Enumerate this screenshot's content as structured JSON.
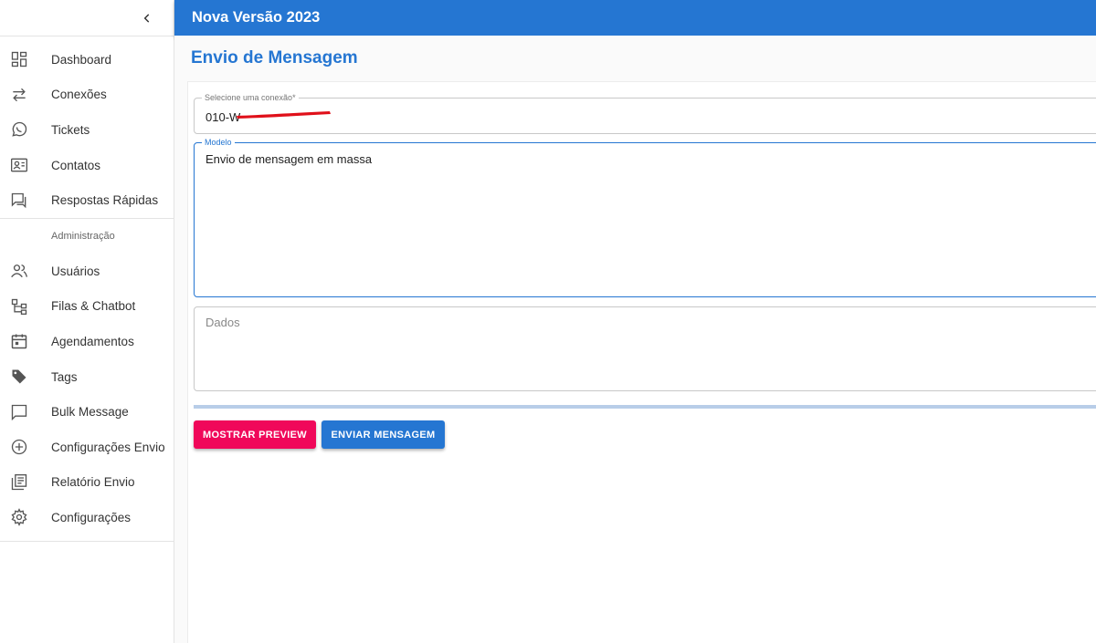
{
  "header": {
    "title": "Nova Versão 2023"
  },
  "sidebar": {
    "collapse_icon": "chevron-left-icon",
    "items": [
      {
        "label": "Dashboard",
        "icon": "dashboard-icon"
      },
      {
        "label": "Conexões",
        "icon": "swap-arrows-icon"
      },
      {
        "label": "Tickets",
        "icon": "whatsapp-icon"
      },
      {
        "label": "Contatos",
        "icon": "contact-card-icon"
      },
      {
        "label": "Respostas Rápidas",
        "icon": "quick-reply-icon"
      }
    ],
    "section_label": "Administração",
    "admin_items": [
      {
        "label": "Usuários",
        "icon": "users-icon"
      },
      {
        "label": "Filas & Chatbot",
        "icon": "flow-tree-icon"
      },
      {
        "label": "Agendamentos",
        "icon": "calendar-icon"
      },
      {
        "label": "Tags",
        "icon": "tag-icon"
      },
      {
        "label": "Bulk Message",
        "icon": "chat-bubble-icon"
      },
      {
        "label": "Configurações Envio",
        "icon": "add-circle-icon"
      },
      {
        "label": "Relatório Envio",
        "icon": "report-library-icon"
      },
      {
        "label": "Configurações",
        "icon": "gear-icon"
      }
    ]
  },
  "main": {
    "page_title": "Envio de Mensagem",
    "connection": {
      "legend": "Selecione uma conexão*",
      "value": "010-W"
    },
    "modelo": {
      "legend": "Modelo",
      "value": "Envio de mensagem em massa"
    },
    "dados": {
      "placeholder": "Dados"
    },
    "progress": 1.0,
    "buttons": {
      "preview": "MOSTRAR PREVIEW",
      "send": "ENVIAR MENSAGEM"
    }
  },
  "colors": {
    "primary": "#2576d2",
    "accent": "#f0085a",
    "redaction": "#e0101a"
  }
}
